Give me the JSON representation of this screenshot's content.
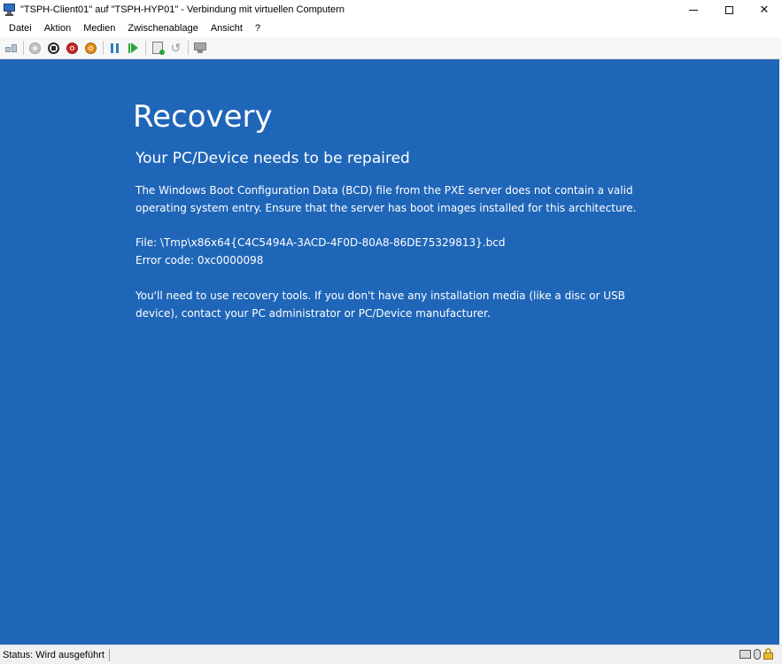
{
  "window": {
    "title": "\"TSPH-Client01\" auf \"TSPH-HYP01\" - Verbindung mit virtuellen Computern",
    "controls": {
      "minimize_icon": "minimize-icon",
      "maximize_icon": "maximize-icon",
      "close_glyph": "✕"
    }
  },
  "menu": {
    "items": [
      "Datei",
      "Aktion",
      "Medien",
      "Zwischenablage",
      "Ansicht",
      "?"
    ]
  },
  "toolbar": {
    "icons": [
      "ctrl-alt-del-icon",
      "start-icon",
      "turn-off-icon",
      "shut-down-icon",
      "save-icon",
      "pause-icon",
      "resume-icon",
      "checkpoint-icon",
      "revert-icon",
      "enhanced-session-icon"
    ],
    "revert_glyph": "↺"
  },
  "vm_screen": {
    "background": "#1f66b8",
    "title": "Recovery",
    "subtitle": "Your PC/Device needs to be repaired",
    "message_line1": "The Windows Boot Configuration Data (BCD) file from the PXE server does not contain a valid",
    "message_line2": "operating system entry. Ensure that the server has boot images installed for this architecture.",
    "file_line": "File: \\Tmp\\x86x64{C4C5494A-3ACD-4F0D-80A8-86DE75329813}.bcd",
    "error_line": "Error code: 0xc0000098",
    "tools_line1": "You'll need to use recovery tools. If you don't have any installation media (like a disc or USB",
    "tools_line2": "device), contact your PC administrator or PC/Device manufacturer."
  },
  "statusbar": {
    "status": "Status: Wird ausgeführt",
    "icons": [
      "keyboard-icon",
      "mouse-icon",
      "lock-icon"
    ]
  }
}
